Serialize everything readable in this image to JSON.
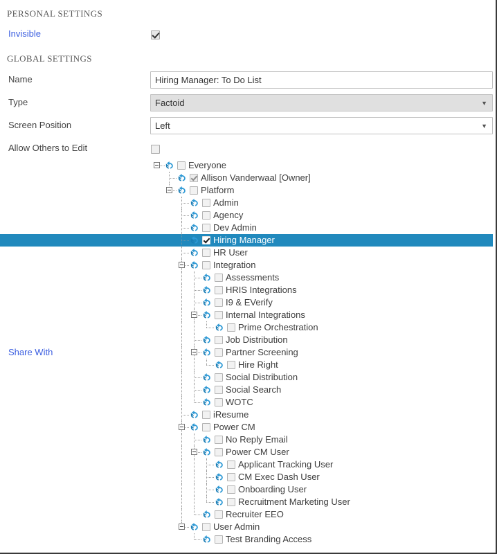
{
  "sections": {
    "personal": "PERSONAL SETTINGS",
    "global": "GLOBAL SETTINGS"
  },
  "fields": {
    "invisible_label": "Invisible",
    "invisible_checked": true,
    "name_label": "Name",
    "name_value": "Hiring Manager: To Do List",
    "type_label": "Type",
    "type_value": "Factoid",
    "screen_position_label": "Screen Position",
    "screen_position_value": "Left",
    "allow_edit_label": "Allow Others to Edit",
    "allow_edit_checked": false,
    "share_with_label": "Share With",
    "caret_glyph": "▼"
  },
  "colors": {
    "selection": "#2189bd",
    "link": "#3b5ee0",
    "icon_blue": "#2f9ad6",
    "disabled_field": "#e0e0e0"
  },
  "tree": {
    "nodes": [
      {
        "label": "Everyone",
        "depth": 0,
        "expander": true,
        "checked": false,
        "dim": false,
        "selected": false
      },
      {
        "label": "Allison Vanderwaal [Owner]",
        "depth": 1,
        "expander": false,
        "checked": true,
        "dim": true,
        "selected": false
      },
      {
        "label": "Platform",
        "depth": 1,
        "expander": true,
        "checked": false,
        "dim": false,
        "selected": false
      },
      {
        "label": "Admin",
        "depth": 2,
        "expander": false,
        "checked": false,
        "dim": false,
        "selected": false
      },
      {
        "label": "Agency",
        "depth": 2,
        "expander": false,
        "checked": false,
        "dim": false,
        "selected": false
      },
      {
        "label": "Dev Admin",
        "depth": 2,
        "expander": false,
        "checked": false,
        "dim": false,
        "selected": false
      },
      {
        "label": "Hiring Manager",
        "depth": 2,
        "expander": false,
        "checked": true,
        "dim": false,
        "selected": true
      },
      {
        "label": "HR User",
        "depth": 2,
        "expander": false,
        "checked": false,
        "dim": false,
        "selected": false
      },
      {
        "label": "Integration",
        "depth": 2,
        "expander": true,
        "checked": false,
        "dim": false,
        "selected": false
      },
      {
        "label": "Assessments",
        "depth": 3,
        "expander": false,
        "checked": false,
        "dim": false,
        "selected": false
      },
      {
        "label": "HRIS Integrations",
        "depth": 3,
        "expander": false,
        "checked": false,
        "dim": false,
        "selected": false
      },
      {
        "label": "I9 & EVerify",
        "depth": 3,
        "expander": false,
        "checked": false,
        "dim": false,
        "selected": false
      },
      {
        "label": "Internal Integrations",
        "depth": 3,
        "expander": true,
        "checked": false,
        "dim": false,
        "selected": false
      },
      {
        "label": "Prime Orchestration",
        "depth": 4,
        "expander": false,
        "checked": false,
        "dim": false,
        "selected": false
      },
      {
        "label": "Job Distribution",
        "depth": 3,
        "expander": false,
        "checked": false,
        "dim": false,
        "selected": false
      },
      {
        "label": "Partner Screening",
        "depth": 3,
        "expander": true,
        "checked": false,
        "dim": false,
        "selected": false
      },
      {
        "label": "Hire Right",
        "depth": 4,
        "expander": false,
        "checked": false,
        "dim": false,
        "selected": false
      },
      {
        "label": "Social Distribution",
        "depth": 3,
        "expander": false,
        "checked": false,
        "dim": false,
        "selected": false
      },
      {
        "label": "Social Search",
        "depth": 3,
        "expander": false,
        "checked": false,
        "dim": false,
        "selected": false
      },
      {
        "label": "WOTC",
        "depth": 3,
        "expander": false,
        "checked": false,
        "dim": false,
        "selected": false
      },
      {
        "label": "iResume",
        "depth": 2,
        "expander": false,
        "checked": false,
        "dim": false,
        "selected": false
      },
      {
        "label": "Power CM",
        "depth": 2,
        "expander": true,
        "checked": false,
        "dim": false,
        "selected": false
      },
      {
        "label": "No Reply Email",
        "depth": 3,
        "expander": false,
        "checked": false,
        "dim": false,
        "selected": false
      },
      {
        "label": "Power CM User",
        "depth": 3,
        "expander": true,
        "checked": false,
        "dim": false,
        "selected": false
      },
      {
        "label": "Applicant Tracking User",
        "depth": 4,
        "expander": false,
        "checked": false,
        "dim": false,
        "selected": false
      },
      {
        "label": "CM Exec Dash User",
        "depth": 4,
        "expander": false,
        "checked": false,
        "dim": false,
        "selected": false
      },
      {
        "label": "Onboarding User",
        "depth": 4,
        "expander": false,
        "checked": false,
        "dim": false,
        "selected": false
      },
      {
        "label": "Recruitment Marketing User",
        "depth": 4,
        "expander": false,
        "checked": false,
        "dim": false,
        "selected": false
      },
      {
        "label": "Recruiter EEO",
        "depth": 3,
        "expander": false,
        "checked": false,
        "dim": false,
        "selected": false
      },
      {
        "label": "User Admin",
        "depth": 2,
        "expander": true,
        "checked": false,
        "dim": false,
        "selected": false
      },
      {
        "label": "Test Branding Access",
        "depth": 3,
        "expander": false,
        "checked": false,
        "dim": false,
        "selected": false
      }
    ]
  }
}
